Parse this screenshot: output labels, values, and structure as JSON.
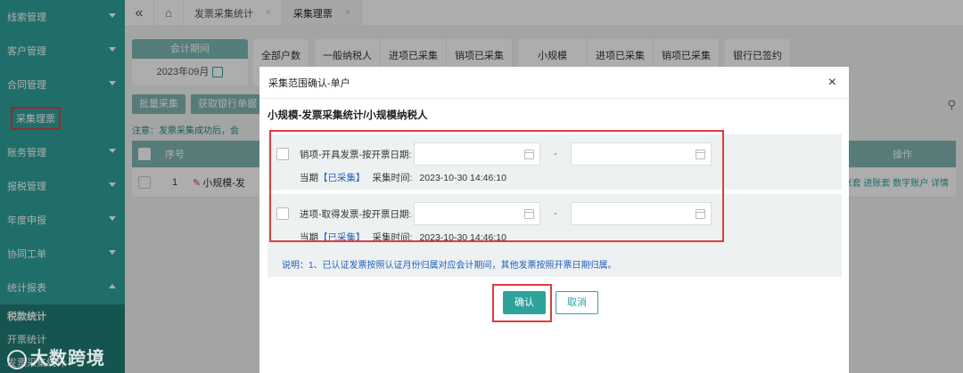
{
  "sidebar": {
    "items": [
      {
        "label": "线索管理"
      },
      {
        "label": "客户管理"
      },
      {
        "label": "合同管理"
      },
      {
        "label": "采集理票"
      },
      {
        "label": "账务管理"
      },
      {
        "label": "报税管理"
      },
      {
        "label": "年度申报"
      },
      {
        "label": "协同工单"
      },
      {
        "label": "统计报表"
      }
    ],
    "submenu": [
      {
        "label": "税款统计"
      },
      {
        "label": "开票统计"
      },
      {
        "label": "发票采集统计"
      }
    ]
  },
  "topbar": {
    "collapse_glyph": "«",
    "home_glyph": "⌂",
    "tabs": [
      {
        "label": "发票采集统计",
        "close": "×"
      },
      {
        "label": "采集理票",
        "close": "×"
      }
    ]
  },
  "filters": {
    "period_head": "会计期间",
    "period_value": "2023年09月",
    "group1": [
      "全部户数"
    ],
    "group2": [
      "一般纳税人",
      "进项已采集",
      "销项已采集"
    ],
    "group3": [
      "小规模",
      "进项已采集",
      "销项已采集"
    ],
    "group4": [
      "银行已签约"
    ]
  },
  "buttons": {
    "batch_collect": "批量采集",
    "get_bank": "获取银行单据"
  },
  "notice": "注意：发票采集成功后，会",
  "table": {
    "idx_header": "序号",
    "ops_header": "操作",
    "rows": [
      {
        "idx": "1",
        "name": "小规模-发",
        "links": "进账套  进账套  数字账户  详情"
      }
    ]
  },
  "modal": {
    "title": "采集范围确认-单户",
    "close": "×",
    "subtitle": "小规模-发票采集统计/小规模纳税人",
    "sections": [
      {
        "label": "销项-开具发票-按开票日期:",
        "dash": "-",
        "status_prefix": "当期",
        "status_tag": "【已采集】",
        "time_label": "采集时间:",
        "time_value": "2023-10-30 14:46:10"
      },
      {
        "label": "进项-取得发票-按开票日期:",
        "dash": "-",
        "status_prefix": "当期",
        "status_tag": "【已采集】",
        "time_label": "采集时间:",
        "time_value": "2023-10-30 14:46:10"
      }
    ],
    "note": "说明：1、已认证发票按照认证月份归属对应会计期间，其他发票按照开票日期归属。",
    "confirm": "确认",
    "cancel": "取消"
  },
  "watermark": "大数跨境",
  "colors": {
    "brand": "#2ea39b",
    "highlight": "#e03c3c",
    "link": "#1f5fbf"
  }
}
